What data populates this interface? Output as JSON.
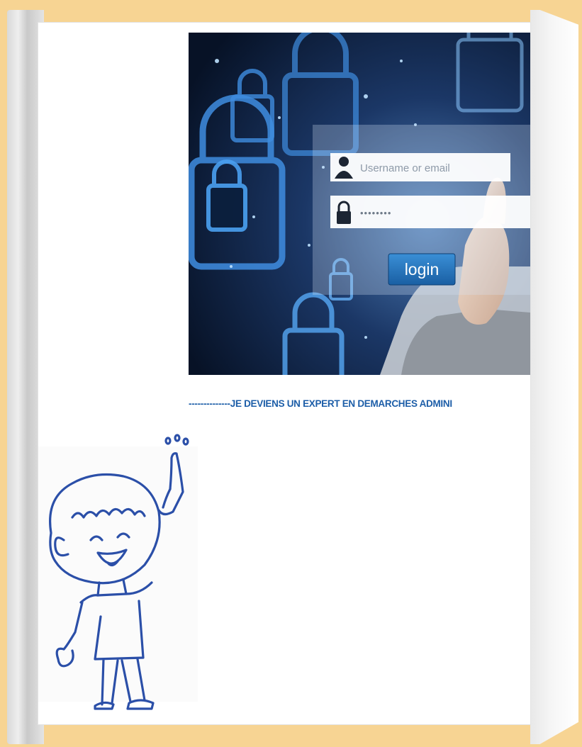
{
  "hero": {
    "username_placeholder": "Username or email",
    "password_mask": "••••••••",
    "login_label": "login"
  },
  "caption": "--------------JE DEVIENS UN EXPERT EN DEMARCHES ADMINI",
  "colors": {
    "background": "#f7d493",
    "caption": "#1d5ea8",
    "illustration_stroke": "#2b4fa8",
    "login_button": "#1f6fb8"
  },
  "icons": [
    "user-icon",
    "padlock-icon"
  ]
}
